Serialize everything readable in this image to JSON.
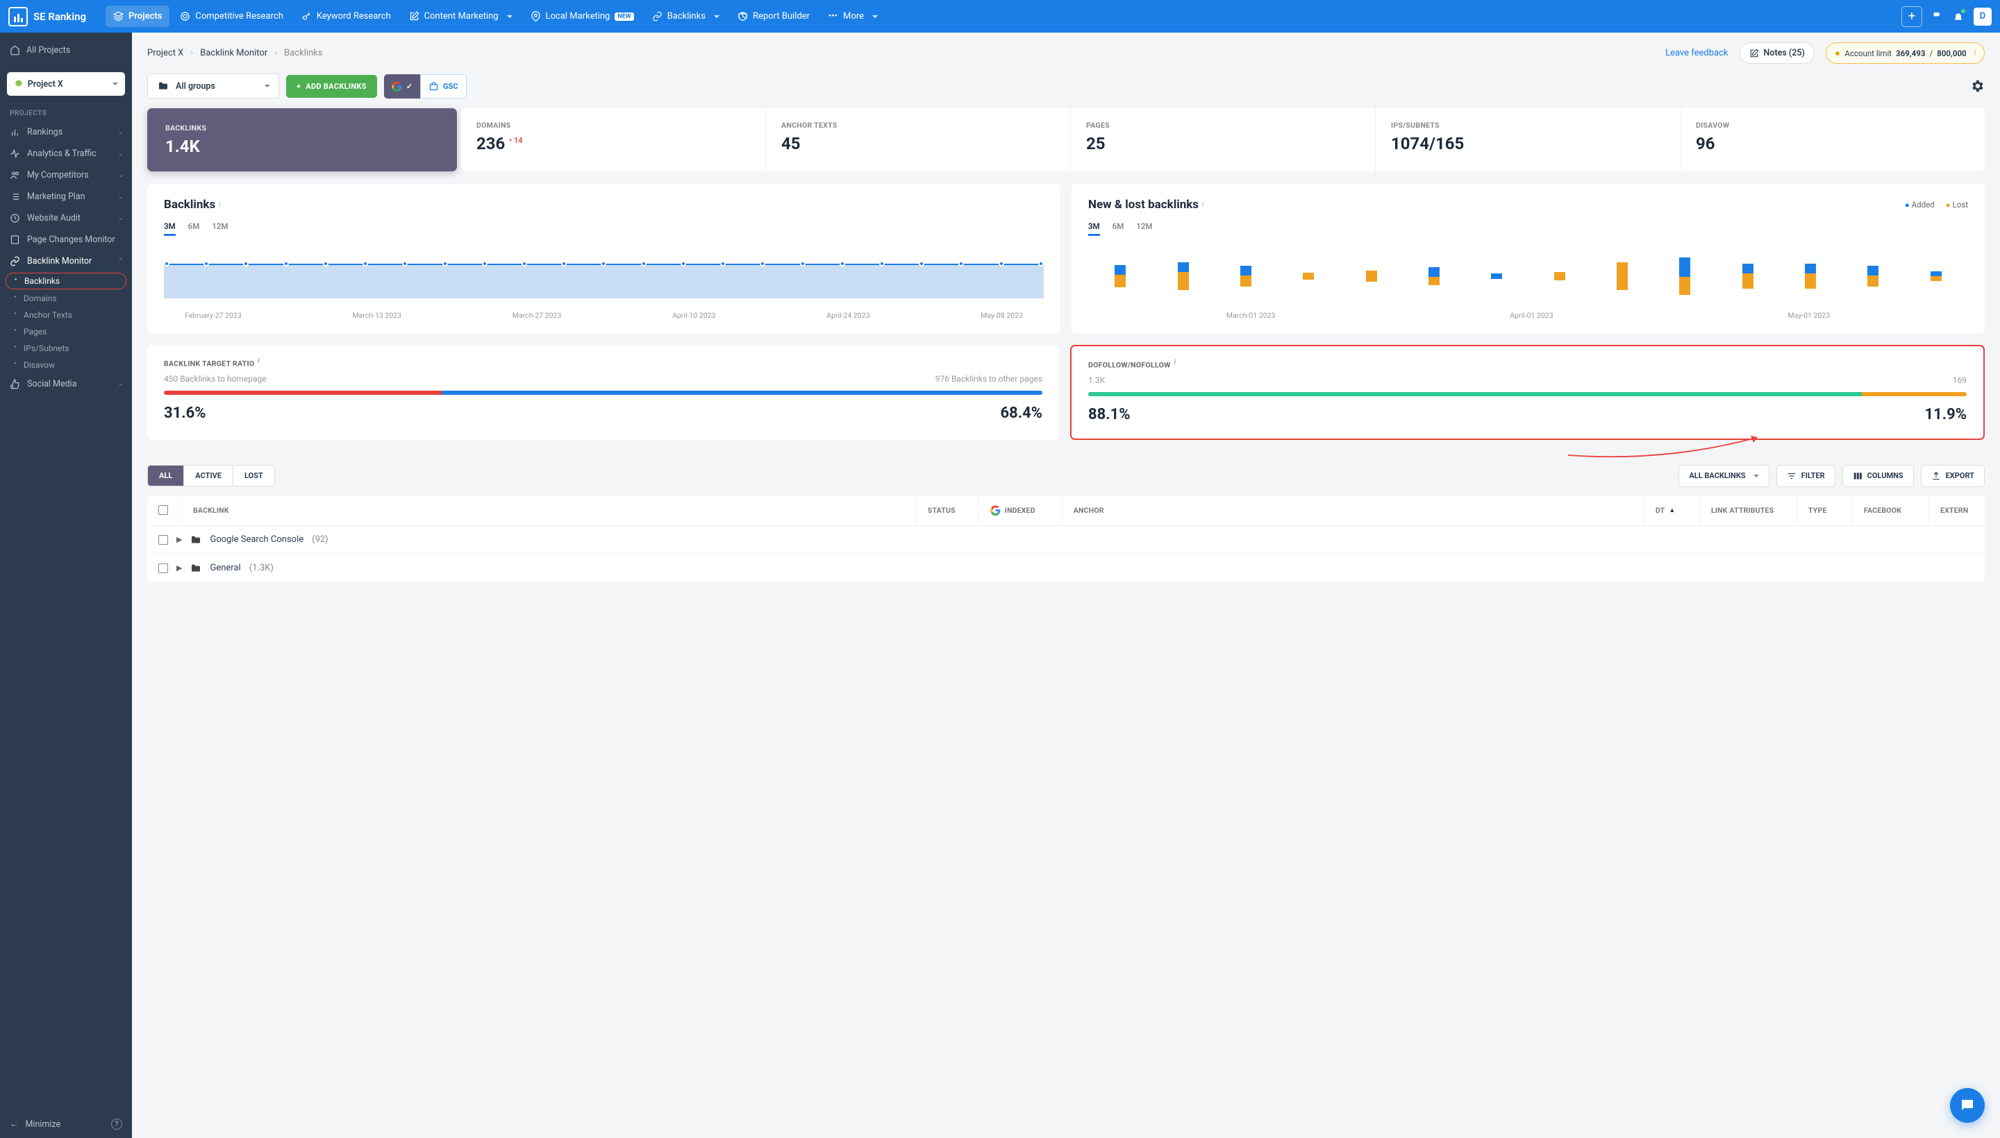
{
  "brand": "SE Ranking",
  "nav": {
    "projects": "Projects",
    "competitive": "Competitive Research",
    "keyword": "Keyword Research",
    "content": "Content Marketing",
    "local": "Local Marketing",
    "local_badge": "NEW",
    "backlinks": "Backlinks",
    "report": "Report Builder",
    "more": "More"
  },
  "avatar_initial": "D",
  "sidebar": {
    "all_projects": "All Projects",
    "project_selected": "Project X",
    "section_label": "PROJECTS",
    "items": {
      "rankings": "Rankings",
      "analytics": "Analytics & Traffic",
      "competitors": "My Competitors",
      "marketing": "Marketing Plan",
      "audit": "Website Audit",
      "pagechanges": "Page Changes Monitor",
      "backlinkmon": "Backlink Monitor",
      "social": "Social Media"
    },
    "sub": {
      "backlinks": "Backlinks",
      "domains": "Domains",
      "anchortexts": "Anchor Texts",
      "pages": "Pages",
      "ips": "IPs/Subnets",
      "disavow": "Disavow"
    },
    "minimize": "Minimize"
  },
  "crumbs": {
    "a": "Project X",
    "b": "Backlink Monitor",
    "c": "Backlinks"
  },
  "topright": {
    "leave_feedback": "Leave feedback",
    "notes": "Notes (25)",
    "acct_label": "Account limit",
    "acct_used": "369,493",
    "acct_sep": " / ",
    "acct_total": "800,000"
  },
  "toolbar": {
    "groups": "All groups",
    "add": "ADD BACKLINKS",
    "gsc": "GSC"
  },
  "metrics": {
    "backlinks": {
      "label": "BACKLINKS",
      "value": "1.4K"
    },
    "domains": {
      "label": "DOMAINS",
      "value": "236",
      "delta": "14"
    },
    "anchors": {
      "label": "ANCHOR TEXTS",
      "value": "45"
    },
    "pages": {
      "label": "PAGES",
      "value": "25"
    },
    "ips": {
      "label": "IPS/SUBNETS",
      "value": "1074/165"
    },
    "disavow": {
      "label": "DISAVOW",
      "value": "96"
    }
  },
  "charts": {
    "backlinks_title": "Backlinks",
    "newlost_title": "New & lost backlinks",
    "legend_added": "Added",
    "legend_lost": "Lost",
    "ranges": {
      "r3m": "3M",
      "r6m": "6M",
      "r12m": "12M"
    },
    "xlabels": [
      "February-27 2023",
      "March-13 2023",
      "March-27 2023",
      "April-10 2023",
      "April-24 2023",
      "May-08 2023"
    ],
    "xlabels2": [
      "March-01 2023",
      "April-01 2023",
      "May-01 2023"
    ]
  },
  "chart_data": [
    {
      "type": "area",
      "title": "Backlinks",
      "series": [
        {
          "name": "Backlinks",
          "values": [
            1400,
            1400,
            1400,
            1400,
            1400,
            1400,
            1400,
            1400,
            1400,
            1400,
            1400,
            1400,
            1400,
            1400,
            1400,
            1400,
            1400,
            1400,
            1400,
            1400,
            1400,
            1400,
            1400
          ]
        }
      ],
      "x": [
        "February-27 2023",
        "March-13 2023",
        "March-27 2023",
        "April-10 2023",
        "April-24 2023",
        "May-08 2023"
      ]
    },
    {
      "type": "bar",
      "title": "New & lost backlinks",
      "series": [
        {
          "name": "Added",
          "values": [
            12,
            12,
            12,
            0,
            0,
            12,
            6,
            0,
            0,
            24,
            12,
            12,
            12,
            6
          ]
        },
        {
          "name": "Lost",
          "values": [
            -16,
            -22,
            -14,
            -8,
            -14,
            -10,
            0,
            -10,
            -34,
            -22,
            -18,
            -18,
            -14,
            -6
          ]
        }
      ],
      "x": [
        "March-01 2023",
        "April-01 2023",
        "May-01 2023"
      ]
    }
  ],
  "ratios": {
    "target": {
      "label": "BACKLINK TARGET RATIO",
      "left_sub": "450 Backlinks to homepage",
      "right_sub": "976 Backlinks to other pages",
      "left_pct": "31.6%",
      "right_pct": "68.4%",
      "left_w": 31.6
    },
    "follow": {
      "label": "DOFOLLOW/NOFOLLOW",
      "left_sub": "1.3K",
      "right_sub": "169",
      "left_pct": "88.1%",
      "right_pct": "11.9%",
      "left_w": 88.1
    }
  },
  "table": {
    "filters": {
      "all": "ALL",
      "active": "ACTIVE",
      "lost": "LOST"
    },
    "tools": {
      "allbl": "ALL BACKLINKS",
      "filter": "FILTER",
      "columns": "COLUMNS",
      "export": "EXPORT"
    },
    "head": {
      "backlink": "BACKLINK",
      "status": "STATUS",
      "indexed": "INDEXED",
      "anchor": "ANCHOR",
      "dt": "DT",
      "linkattr": "LINK ATTRIBUTES",
      "type": "TYPE",
      "facebook": "FACEBOOK",
      "extern": "EXTERN"
    },
    "rows": [
      {
        "name": "Google Search Console",
        "count": "(92)"
      },
      {
        "name": "General",
        "count": "(1.3K)"
      }
    ]
  }
}
